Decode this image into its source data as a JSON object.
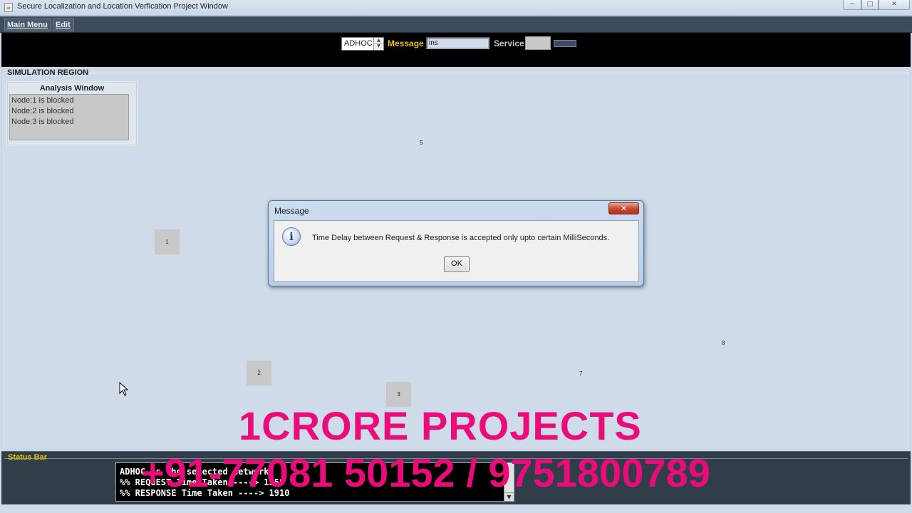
{
  "window": {
    "title": "Secure Localization and Location Verfication Project Window",
    "icon": "java-cup-icon",
    "controls": {
      "minimize": "−",
      "maximize": "□",
      "close": "✕"
    }
  },
  "menu": {
    "items": [
      {
        "label": "Main Menu"
      },
      {
        "label": "Edit"
      }
    ]
  },
  "toolbar": {
    "network_value": "ADHOC",
    "spin_up": "▲",
    "spin_down": "▼",
    "message_label": "Message",
    "message_value": "ins",
    "service_label": "Service"
  },
  "simulation": {
    "legend": "SIMULATION REGION",
    "analysis": {
      "title": "Analysis Window",
      "lines": [
        "Node:1 is blocked",
        "Node:2 is blocked",
        "Node:3 is blocked"
      ]
    },
    "nodes": {
      "n1": "1",
      "n2": "2",
      "n3": "3",
      "n5": "5",
      "n7": "7",
      "n8": "8"
    }
  },
  "dialog": {
    "title": "Message",
    "close": "✕",
    "icon": "information-icon",
    "icon_glyph": "i",
    "text": "Time Delay between Request & Response is accepted only upto certain MilliSeconds.",
    "ok": "OK"
  },
  "status": {
    "legend": "Status Bar",
    "console_lines": [
      "ADHOC is the selected network",
      " %% REQUEST Time Taken ----> 1358",
      " %% RESPONSE Time Taken ----> 1910"
    ],
    "scroll_down": "▼"
  },
  "watermark": {
    "line1": "1CRORE PROJECTS",
    "line2": "+91-77081 50152 / 9751800789"
  },
  "colors": {
    "background": "#cfdbe9",
    "toolbar": "#000000",
    "message_label": "#e8c300",
    "watermark": "#ea0c7b"
  }
}
